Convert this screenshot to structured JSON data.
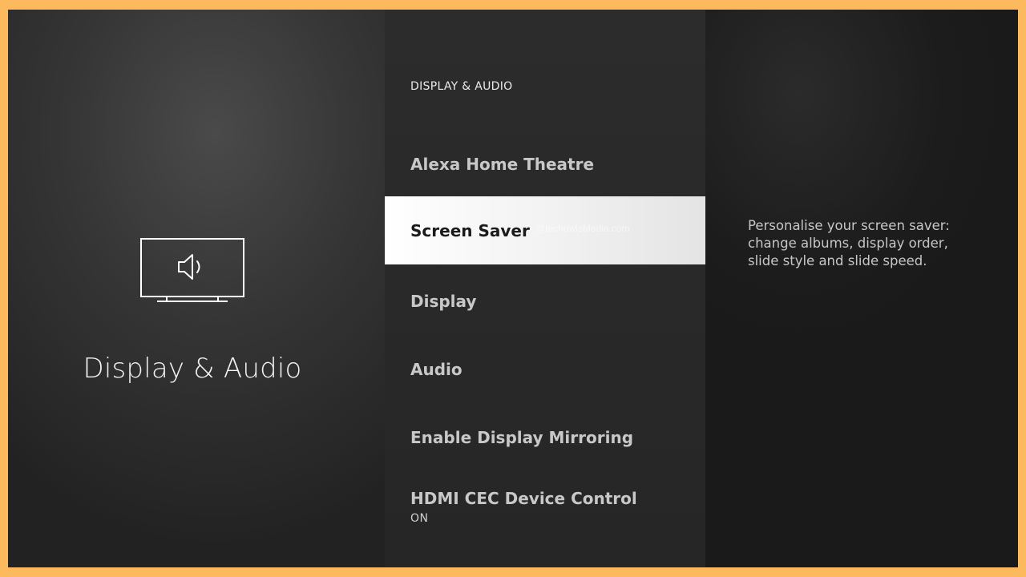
{
  "category": {
    "title": "Display & Audio",
    "icon": "tv-speaker-icon"
  },
  "menu": {
    "heading": "DISPLAY & AUDIO",
    "items": [
      {
        "label": "Alexa Home Theatre",
        "sub": ""
      },
      {
        "label": "Screen Saver",
        "sub": "",
        "selected": true,
        "watermark": "@techowlsMedia.com"
      },
      {
        "label": "Display",
        "sub": ""
      },
      {
        "label": "Audio",
        "sub": ""
      },
      {
        "label": "Enable Display Mirroring",
        "sub": ""
      },
      {
        "label": "HDMI CEC Device Control",
        "sub": "ON"
      }
    ]
  },
  "description": {
    "text": "Personalise your screen saver: change albums, display order, slide style and slide speed."
  },
  "colors": {
    "border": "#fcb95e",
    "selected_background": "#ffffff",
    "panel_dark": "#262626"
  }
}
